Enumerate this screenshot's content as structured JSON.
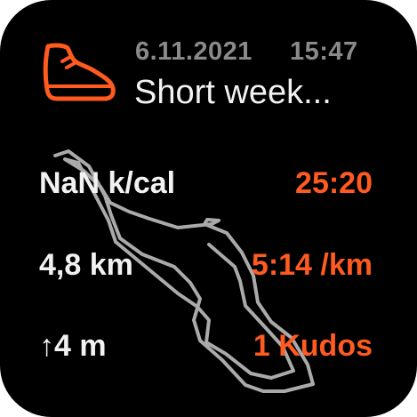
{
  "activity": {
    "icon": "running-shoe-icon",
    "date": "6.11.2021",
    "time": "15:47",
    "title": "Short week...",
    "accent_color": "#ff5a1f"
  },
  "stats": {
    "calories": "NaN k/cal",
    "duration": "25:20",
    "distance": "4,8 km",
    "pace": "5:14 /km",
    "elevation": "↑4 m",
    "kudos": "1 Kudos"
  }
}
